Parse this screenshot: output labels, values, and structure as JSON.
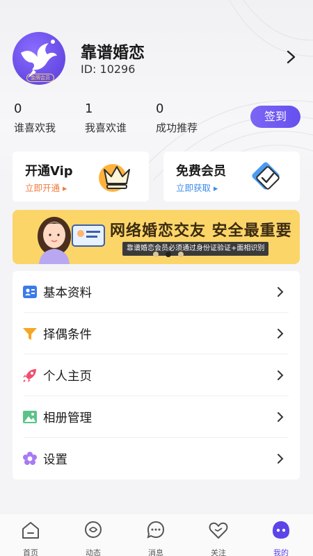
{
  "profile": {
    "name": "靠谱婚恋",
    "id_text": "ID: 10296",
    "avatar_badge": "金牌会员"
  },
  "stats": [
    {
      "value": "0",
      "label": "谁喜欢我"
    },
    {
      "value": "1",
      "label": "我喜欢谁"
    },
    {
      "value": "0",
      "label": "成功推荐"
    }
  ],
  "checkin_label": "签到",
  "cards": {
    "vip": {
      "title": "开通Vip",
      "sub": "立即开通 ▸"
    },
    "free": {
      "title": "免费会员",
      "sub": "立即获取 ▸"
    }
  },
  "banner": {
    "title": "网络婚恋交友 安全最重要",
    "subtitle": "靠谱婚恋会员必须通过身份证验证+面相识别"
  },
  "menu": [
    {
      "label": "基本资料",
      "icon": "profile-card-icon"
    },
    {
      "label": "择偶条件",
      "icon": "filter-icon"
    },
    {
      "label": "个人主页",
      "icon": "rocket-icon"
    },
    {
      "label": "相册管理",
      "icon": "photo-icon"
    },
    {
      "label": "设置",
      "icon": "flower-settings-icon"
    }
  ],
  "tabbar": [
    {
      "label": "首页",
      "icon": "home-icon"
    },
    {
      "label": "动态",
      "icon": "moments-icon"
    },
    {
      "label": "消息",
      "icon": "message-icon"
    },
    {
      "label": "关注",
      "icon": "heart-icon"
    },
    {
      "label": "我的",
      "icon": "me-icon",
      "active": true
    }
  ],
  "colors": {
    "accent": "#6650ef",
    "vip_sub": "#f07a3c",
    "free_sub": "#3b8be8",
    "banner_bg": "#fcd569"
  }
}
